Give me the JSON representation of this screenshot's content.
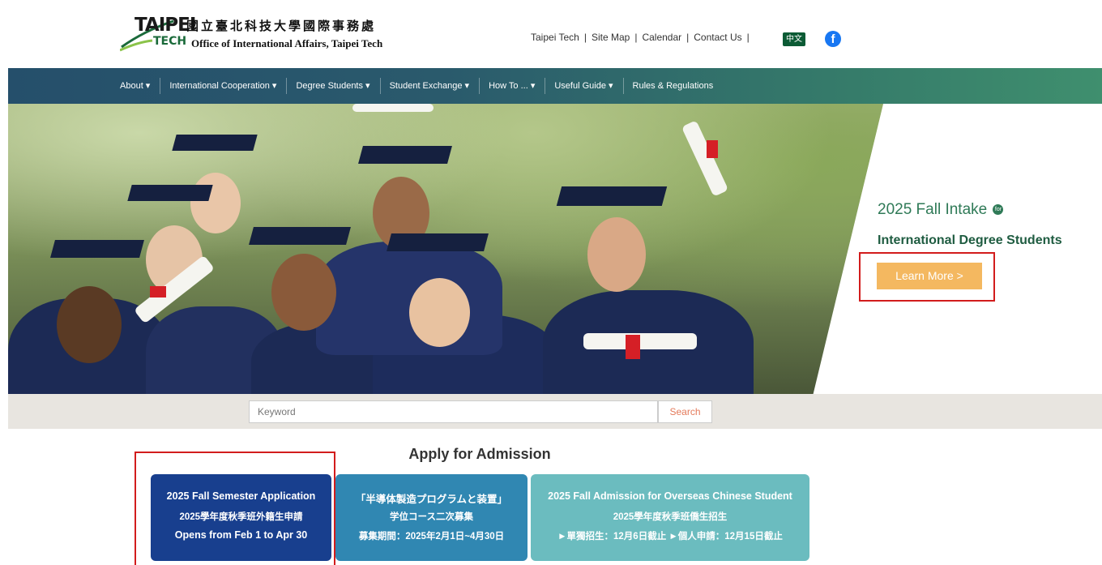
{
  "header": {
    "logo_taipei": "TAIPEI",
    "logo_tech": "TECH",
    "logo_chinese": "國立臺北科技大學國際事務處",
    "logo_english": "Office of International Affairs, Taipei Tech",
    "top_links": [
      "Taipei Tech",
      "Site Map",
      "Calendar",
      "Contact Us"
    ],
    "language_button": "中文",
    "facebook_glyph": "f"
  },
  "nav": {
    "items": [
      "About ▾",
      "International Cooperation ▾",
      "Degree Students ▾",
      "Student Exchange ▾",
      "How To ... ▾",
      "Useful Guide ▾",
      "Rules & Regulations"
    ]
  },
  "hero": {
    "title": "2025 Fall Intake",
    "for_badge": "for",
    "subtitle": "International Degree Students",
    "button": "Learn More >",
    "button_color": "#f4b860"
  },
  "search": {
    "placeholder": "Keyword",
    "button": "Search"
  },
  "apply": {
    "title": "Apply for Admission",
    "cards": [
      {
        "line1": "2025 Fall Semester Application",
        "line2": "2025學年度秋季班外籍生申請",
        "line3": "Opens from Feb 1 to Apr 30",
        "color": "#183f8e"
      },
      {
        "line1": "「半導体製造プログラムと装置」",
        "line2": "学位コース二次募集",
        "line3": "募集期間：2025年2月1日~4月30日",
        "color": "#3087b2"
      },
      {
        "line1": "2025 Fall Admission for Overseas Chinese Student",
        "line2": "2025學年度秋季班僑生招生",
        "line3": "►單獨招生：12月6日截止 ►個人申請：12月15日截止",
        "color": "#6bbcbf"
      }
    ]
  },
  "colors": {
    "nav_start": "#254f6b",
    "nav_end": "#3f8f6e",
    "accent_green": "#2f7a57",
    "highlight_red": "#d21c1c"
  }
}
